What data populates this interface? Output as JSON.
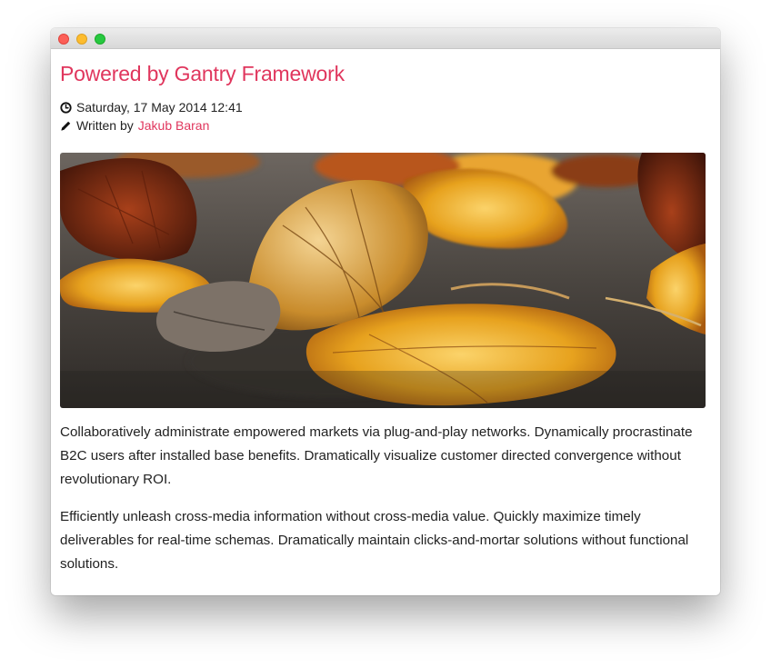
{
  "window": {
    "controls": [
      "close",
      "minimize",
      "maximize"
    ]
  },
  "article": {
    "title": "Powered by Gantry Framework",
    "date": "Saturday, 17 May 2014 12:41",
    "written_by_label": "Written by",
    "author": "Jakub Baran",
    "image": {
      "subject": "autumn leaves on pavement"
    },
    "paragraphs": [
      "Collaboratively administrate empowered markets via plug-and-play networks. Dynamically procrastinate B2C users after installed base benefits. Dramatically visualize customer directed convergence without revolutionary ROI.",
      "Efficiently unleash cross-media information without cross-media value. Quickly maximize timely deliverables for real-time schemas. Dramatically maintain clicks-and-mortar solutions without functional solutions."
    ]
  },
  "colors": {
    "accent": "#e0365d",
    "text": "#222222"
  },
  "icons": {
    "date": "clock-icon",
    "author": "pencil-icon"
  }
}
